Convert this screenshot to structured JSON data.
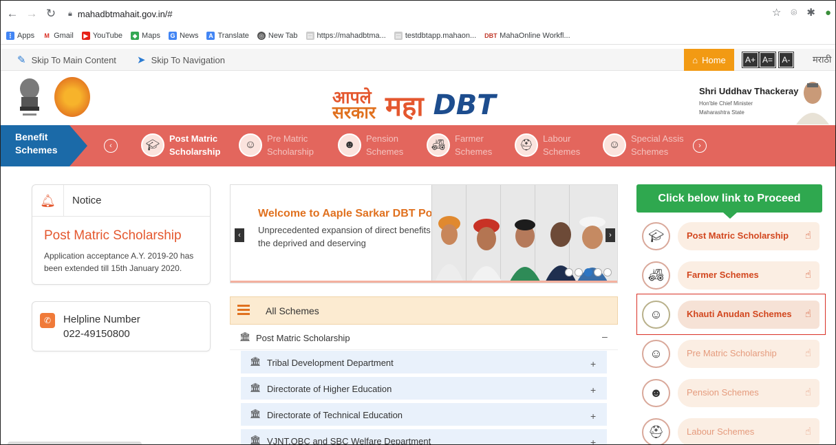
{
  "browser": {
    "url": "mahadbtmahait.gov.in/#",
    "bookmarks": [
      "Apps",
      "Gmail",
      "YouTube",
      "Maps",
      "News",
      "Translate",
      "New Tab",
      "https://mahadbtma...",
      "testdbtapp.mahaon...",
      "MahaOnline Workfl..."
    ]
  },
  "topbar": {
    "skip_main": "Skip To Main Content",
    "skip_nav": "Skip To Navigation",
    "home": "Home",
    "font_plus": "A+",
    "font_eq": "A=",
    "font_minus": "A-",
    "language": "मराठी"
  },
  "header": {
    "logo_aaple_1": "आपले",
    "logo_aaple_2": "सरकार",
    "logo_maha": "महा",
    "logo_dbt": "DBT",
    "cm_name": "Shri Uddhav Thackeray",
    "cm_title": "Hon'ble Chief Minister",
    "cm_state": "Maharashtra State"
  },
  "scheme_nav": {
    "benefit_1": "Benefit",
    "benefit_2": "Schemes",
    "items": [
      {
        "line1": "Post Matric",
        "line2": "Scholarship"
      },
      {
        "line1": "Pre Matric",
        "line2": "Scholarship"
      },
      {
        "line1": "Pension",
        "line2": "Schemes"
      },
      {
        "line1": "Farmer",
        "line2": "Schemes"
      },
      {
        "line1": "Labour",
        "line2": "Schemes"
      },
      {
        "line1": "Special Assis",
        "line2": "Schemes"
      }
    ]
  },
  "notice": {
    "title": "Notice",
    "headline": "Post Matric Scholarship",
    "text": "Application acceptance A.Y. 2019-20 has been extended till 15th January 2020."
  },
  "helpline": {
    "title": "Helpline Number",
    "number": "022-49150800"
  },
  "slider": {
    "title": "Welcome to Aaple Sarkar DBT Portal",
    "text": "Unprecedented expansion of direct benefits to the deprived and deserving"
  },
  "all_schemes": {
    "title": "All Schemes",
    "group": "Post Matric Scholarship",
    "group_toggle": "–",
    "departments": [
      "Tribal Development Department",
      "Directorate of Higher Education",
      "Directorate of Technical Education",
      "VJNT,OBC and SBC Welfare Department"
    ],
    "dept_toggle": "+"
  },
  "proceed": {
    "title": "Click below link to Proceed",
    "links": [
      "Post Matric Scholarship",
      "Farmer Schemes",
      "Khauti Anudan Schemes",
      "Pre Matric Scholarship",
      "Pension Schemes",
      "Labour Schemes"
    ]
  }
}
